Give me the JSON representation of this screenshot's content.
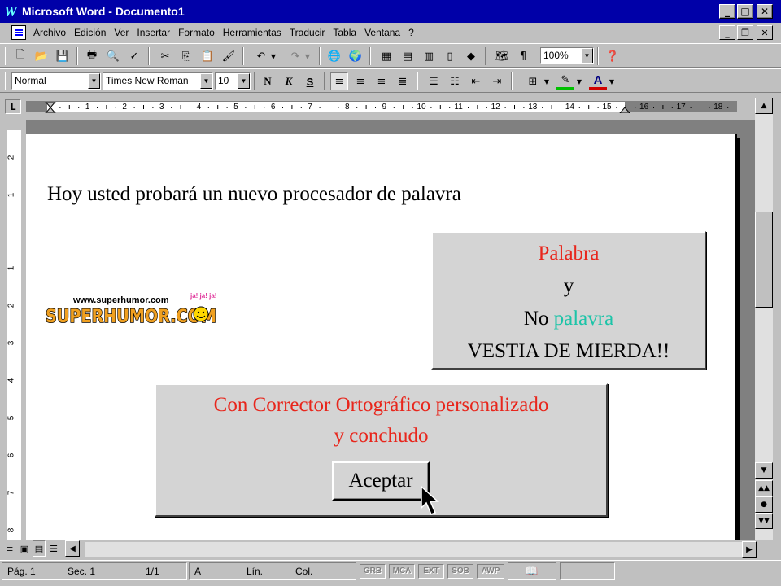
{
  "window": {
    "title": "Microsoft Word - Documento1",
    "app_icon": "W",
    "min": "_",
    "max": "□",
    "close": "✕"
  },
  "menu": {
    "items": [
      "Archivo",
      "Edición",
      "Ver",
      "Insertar",
      "Formato",
      "Herramientas",
      "Traducir",
      "Tabla",
      "Ventana",
      "?"
    ]
  },
  "toolbar_standard": {
    "zoom": "100%"
  },
  "toolbar_format": {
    "style": "Normal",
    "font": "Times New Roman",
    "size": "10",
    "bold": "N",
    "italic": "K",
    "underline": "S"
  },
  "ruler": {
    "numbers": [
      "1",
      "2",
      "3",
      "4",
      "5",
      "6",
      "7",
      "8",
      "9",
      "10",
      "11",
      "12",
      "13",
      "14",
      "15",
      "16",
      "17",
      "18"
    ],
    "vnumbers": [
      "2",
      "1",
      "1",
      "2",
      "3",
      "4",
      "5",
      "6",
      "7",
      "8"
    ]
  },
  "document": {
    "text": "Hoy usted probará un nuevo procesador de palavra"
  },
  "logo": {
    "url": "www.superhumor.com",
    "name": "SUPERHUMOR.COM",
    "laughs": "ja! ja! ja!"
  },
  "dialog1": {
    "line1": "Palabra",
    "line2": "y",
    "line3a": "No ",
    "line3b": "palavra",
    "line4": "VESTIA DE MIERDA!!"
  },
  "dialog2": {
    "line1": "Con Corrector Ortográfico personalizado",
    "line2": "y conchudo",
    "ok": "Aceptar"
  },
  "status": {
    "page": "Pág. 1",
    "section": "Sec. 1",
    "pages": "1/1",
    "at": "A",
    "line": "Lín.",
    "col": "Col.",
    "grb": "GRB",
    "mca": "MCA",
    "ext": "EXT",
    "sob": "SOB",
    "awp": "AWP"
  },
  "colors": {
    "titlebar": "#0000a8",
    "red": "#e8261c",
    "teal": "#1cc4a8"
  }
}
